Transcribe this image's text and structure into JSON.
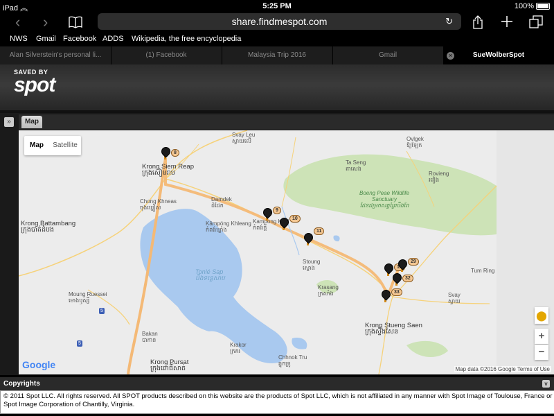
{
  "status_bar": {
    "device": "iPad",
    "time": "5:25 PM",
    "battery": "100%"
  },
  "browser": {
    "url": "share.findmespot.com",
    "bookmarks": [
      "NWS",
      "Gmail",
      "Facebook",
      "ADDS",
      "Wikipedia, the free encyclopedia"
    ],
    "tabs": [
      {
        "label": "Alan Silverstein's personal li..."
      },
      {
        "label": "(1) Facebook"
      },
      {
        "label": "Malaysia Trip 2016"
      },
      {
        "label": "Gmail"
      },
      {
        "label": "SueWolberSpot"
      }
    ],
    "close_tab_glyph": "×",
    "icons": [
      "back-icon",
      "forward-icon",
      "bookmarks-icon",
      "reload-icon",
      "share-icon",
      "add-tab-icon",
      "tabs-icon"
    ]
  },
  "header": {
    "logo_top": "SAVED BY",
    "logo_main": "spot"
  },
  "panel": {
    "expand_glyph": "»",
    "map_tab": "Map"
  },
  "map": {
    "type_buttons": [
      "Map",
      "Satellite"
    ],
    "selected_type": "Map",
    "colors": {
      "water": "#a9c9ef",
      "park": "#cde3b7",
      "route": "#f4b976",
      "road": "#f6d27a",
      "land": "#ececec"
    },
    "places": [
      {
        "name": "Svay Leu",
        "khmer": "ស្វាយលើ"
      },
      {
        "name": "Krong Siem Reap",
        "khmer": "ក្រុងសៀមរាប"
      },
      {
        "name": "Damdek",
        "khmer": "ដំដែក"
      },
      {
        "name": "Chong Khneas",
        "khmer": "ចុងឃ្នៀស"
      },
      {
        "name": "Krong Battambang",
        "khmer": "ក្រុងបាត់ដំបង"
      },
      {
        "name": "Kâmpóng Khleang",
        "khmer": "កំពង់ឃ្លាំង"
      },
      {
        "name": "Kampong Kdei",
        "khmer": "កំពង់ក្តី"
      },
      {
        "name": "Tonlé Sap",
        "khmer": "បឹងទន្លេសាប"
      },
      {
        "name": "Ta Seng",
        "khmer": "តាសេង"
      },
      {
        "name": "Ovlgek",
        "khmer": "ឱ្យឡែក"
      },
      {
        "name": "Rovieng",
        "khmer": "រវៀង"
      },
      {
        "name": "Boeng Peae Wildlife Sanctuary",
        "khmer": "ដែនជម្រកសត្វព្រៃបឹងពែ"
      },
      {
        "name": "Stoung",
        "khmer": "ស្ទោង"
      },
      {
        "name": "Krasang",
        "khmer": "ក្រសាំង"
      },
      {
        "name": "Tum Ring",
        "khmer": ""
      },
      {
        "name": "Svay",
        "khmer": "ស្វាយ"
      },
      {
        "name": "Moung Ruessei",
        "khmer": "មោងឫស្សី"
      },
      {
        "name": "Krong Stueng Saen",
        "khmer": "ក្រុងស្ទឹងសែន"
      },
      {
        "name": "Bakan",
        "khmer": "បាកាន"
      },
      {
        "name": "Krakor",
        "khmer": "ក្រគរ"
      },
      {
        "name": "Chhnok Tru",
        "khmer": "ឆ្នុកទ្រូ"
      },
      {
        "name": "Krong Pursat",
        "khmer": "ក្រុងពោធិ៍សាត់"
      }
    ],
    "road_shields": [
      "5",
      "5"
    ],
    "markers": [
      {
        "label": "8"
      },
      {
        "label": "9"
      },
      {
        "label": "10"
      },
      {
        "label": "11"
      },
      {
        "label": "12"
      },
      {
        "label": "29"
      },
      {
        "label": "32"
      },
      {
        "label": "33"
      }
    ],
    "zoom_in": "+",
    "zoom_out": "−",
    "google": "Google",
    "attribution": "Map data ©2016 Google   Terms of Use"
  },
  "copyrights": {
    "title": "Copyrights",
    "collapse_glyph": "v",
    "text": "© 2011 Spot LLC. All rights reserved. All SPOT products described on this website are the products of Spot LLC, which is not affiliated in any manner with Spot Image of Toulouse, France or Spot Image Corporation of Chantilly, Virginia."
  }
}
